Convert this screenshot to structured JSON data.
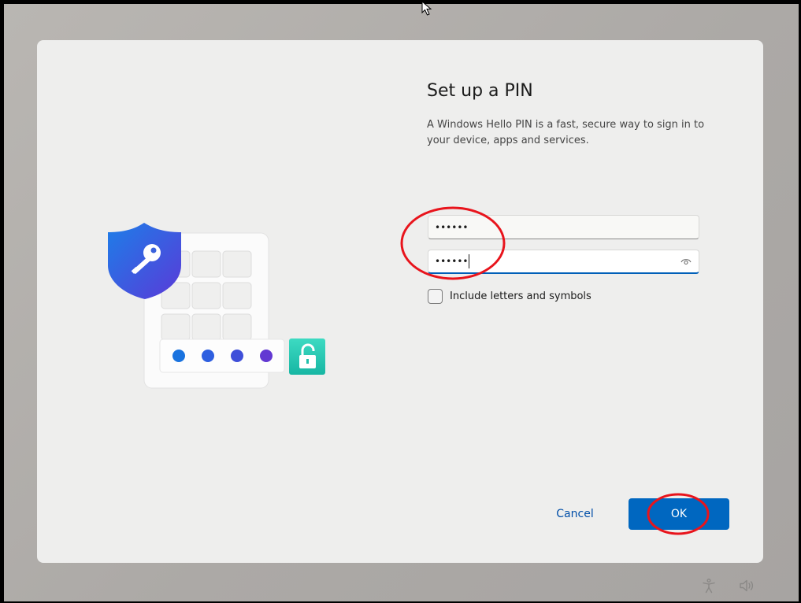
{
  "page": {
    "title": "Set up a PIN",
    "description": "A Windows Hello PIN is a fast, secure way to sign in to your device, apps and services."
  },
  "pin_fields": [
    {
      "value": "••••••",
      "focused": false
    },
    {
      "value": "••••••",
      "focused": true
    }
  ],
  "options": {
    "include_letters_label": "Include letters and symbols",
    "include_letters_checked": false
  },
  "buttons": {
    "cancel_label": "Cancel",
    "ok_label": "OK"
  },
  "colors": {
    "accent": "#0067c0",
    "link": "#004ea8",
    "annotation": "#e8141c"
  },
  "icons": {
    "reveal": "eye-icon",
    "accessibility": "accessibility-icon",
    "volume": "volume-icon"
  }
}
